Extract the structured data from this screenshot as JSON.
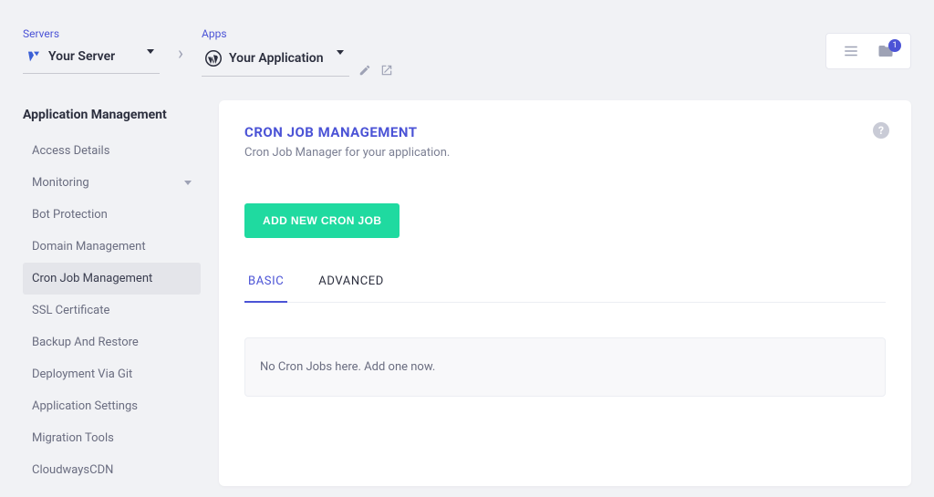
{
  "breadcrumb": {
    "servers_label": "Servers",
    "server_name": "Your Server",
    "apps_label": "Apps",
    "app_name": "Your Application"
  },
  "top_right": {
    "notification_count": "1"
  },
  "sidebar": {
    "title": "Application Management",
    "items": [
      {
        "label": "Access Details",
        "expandable": false
      },
      {
        "label": "Monitoring",
        "expandable": true
      },
      {
        "label": "Bot Protection",
        "expandable": false
      },
      {
        "label": "Domain Management",
        "expandable": false
      },
      {
        "label": "Cron Job Management",
        "expandable": false,
        "active": true
      },
      {
        "label": "SSL Certificate",
        "expandable": false
      },
      {
        "label": "Backup And Restore",
        "expandable": false
      },
      {
        "label": "Deployment Via Git",
        "expandable": false
      },
      {
        "label": "Application Settings",
        "expandable": false
      },
      {
        "label": "Migration Tools",
        "expandable": false
      },
      {
        "label": "CloudwaysCDN",
        "expandable": false
      }
    ]
  },
  "content": {
    "title": "CRON JOB MANAGEMENT",
    "subtitle": "Cron Job Manager for your application.",
    "add_button": "ADD NEW CRON JOB",
    "tabs": [
      {
        "label": "BASIC",
        "active": true
      },
      {
        "label": "ADVANCED",
        "active": false
      }
    ],
    "empty_message": "No Cron Jobs here. Add one now.",
    "help_tooltip": "?"
  }
}
